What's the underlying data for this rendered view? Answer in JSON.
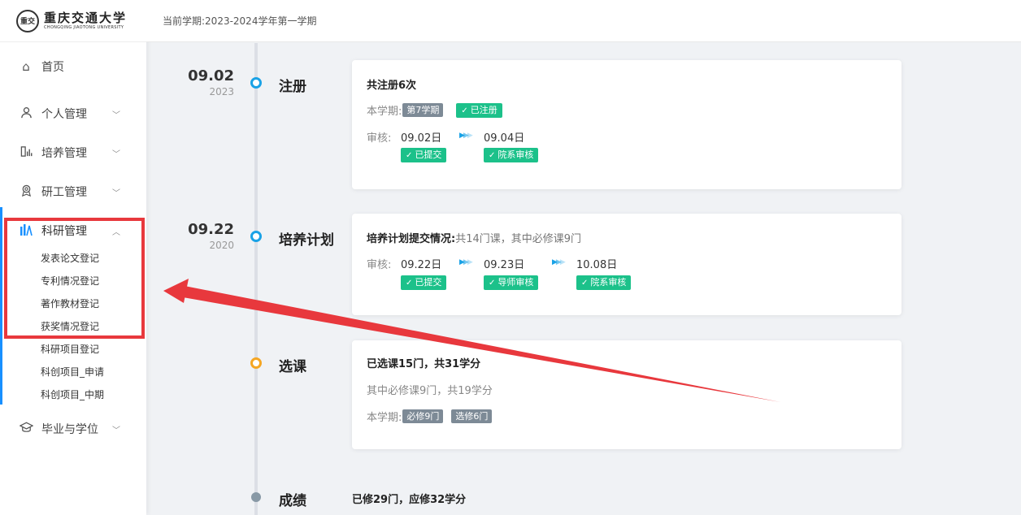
{
  "logo": {
    "seal": "重交",
    "name_cn": "重庆交通大学",
    "name_en": "CHONGQING JIAOTONG UNIVERSITY"
  },
  "header": {
    "semester": "当前学期:2023-2024学年第一学期"
  },
  "sidebar": {
    "items": [
      {
        "label": "首页",
        "icon": "home-icon"
      },
      {
        "label": "个人管理",
        "icon": "user-icon"
      },
      {
        "label": "培养管理",
        "icon": "chart-book-icon"
      },
      {
        "label": "研工管理",
        "icon": "badge-icon"
      },
      {
        "label": "科研管理",
        "icon": "bar-chart-icon"
      },
      {
        "label": "毕业与学位",
        "icon": "graduation-cap-icon"
      }
    ],
    "sub_items": [
      "发表论文登记",
      "专利情况登记",
      "著作教材登记",
      "获奖情况登记",
      "科研项目登记",
      "科创项目_申请",
      "科创项目_中期"
    ]
  },
  "timeline": {
    "reg": {
      "date": "09.02",
      "year": "2023",
      "title": "注册",
      "head": "共注册6次",
      "term_label": "本学期:",
      "term_tag": "第7学期",
      "status_tag": "已注册",
      "review_label": "审核:",
      "steps": [
        {
          "date": "09.02日",
          "tag": "已提交"
        },
        {
          "date": "09.04日",
          "tag": "院系审核"
        }
      ]
    },
    "plan": {
      "date": "09.22",
      "year": "2020",
      "title": "培养计划",
      "head_bold": "培养计划提交情况:",
      "head_rest": "共14门课，其中必修课9门",
      "review_label": "审核:",
      "steps": [
        {
          "date": "09.22日",
          "tag": "已提交"
        },
        {
          "date": "09.23日",
          "tag": "导师审核"
        },
        {
          "date": "10.08日",
          "tag": "院系审核"
        }
      ]
    },
    "course": {
      "title": "选课",
      "head": "已选课15门，共31学分",
      "line2": "其中必修课9门，共19学分",
      "term_label": "本学期:",
      "tag1": "必修9门",
      "tag2": "选修6门"
    },
    "grade": {
      "title": "成绩",
      "head": "已修29门，应修32学分"
    }
  },
  "colors": {
    "accent": "#1890ff",
    "timeline_blue": "#1aa2e6",
    "timeline_orange": "#f5a623",
    "tag_green": "#1cc18a",
    "tag_gray": "#7d8a96",
    "annotation_red": "#e8383d"
  }
}
